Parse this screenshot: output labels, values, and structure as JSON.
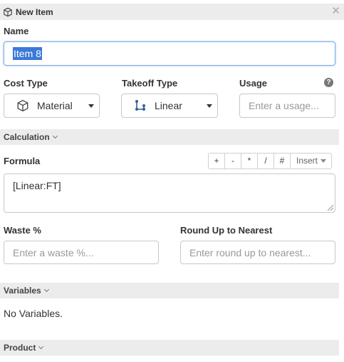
{
  "window": {
    "title": "New Item",
    "close_glyph": "✕",
    "icon": "cube-icon"
  },
  "name": {
    "label": "Name",
    "value": "Item 8"
  },
  "cost_type": {
    "label": "Cost Type",
    "value": "Material",
    "icon": "cube-icon"
  },
  "takeoff_type": {
    "label": "Takeoff Type",
    "value": "Linear",
    "icon": "linear-takeoff-icon"
  },
  "usage": {
    "label": "Usage",
    "placeholder": "Enter a usage...",
    "help_glyph": "?"
  },
  "calculation": {
    "label": "Calculation"
  },
  "formula": {
    "label": "Formula",
    "value": "[Linear:FT]",
    "operators": [
      "+",
      "-",
      "*",
      "/",
      "#"
    ],
    "insert_label": "Insert"
  },
  "waste": {
    "label": "Waste %",
    "placeholder": "Enter a waste %..."
  },
  "round_up": {
    "label": "Round Up to Nearest",
    "placeholder": "Enter round up to nearest..."
  },
  "variables": {
    "label": "Variables",
    "empty_text": "No Variables."
  },
  "product": {
    "label": "Product"
  },
  "colors": {
    "selection": "#3b78d8",
    "focus_border": "#7aaee8",
    "section_bg": "#ececec",
    "icon_blue": "#2f5f98"
  }
}
